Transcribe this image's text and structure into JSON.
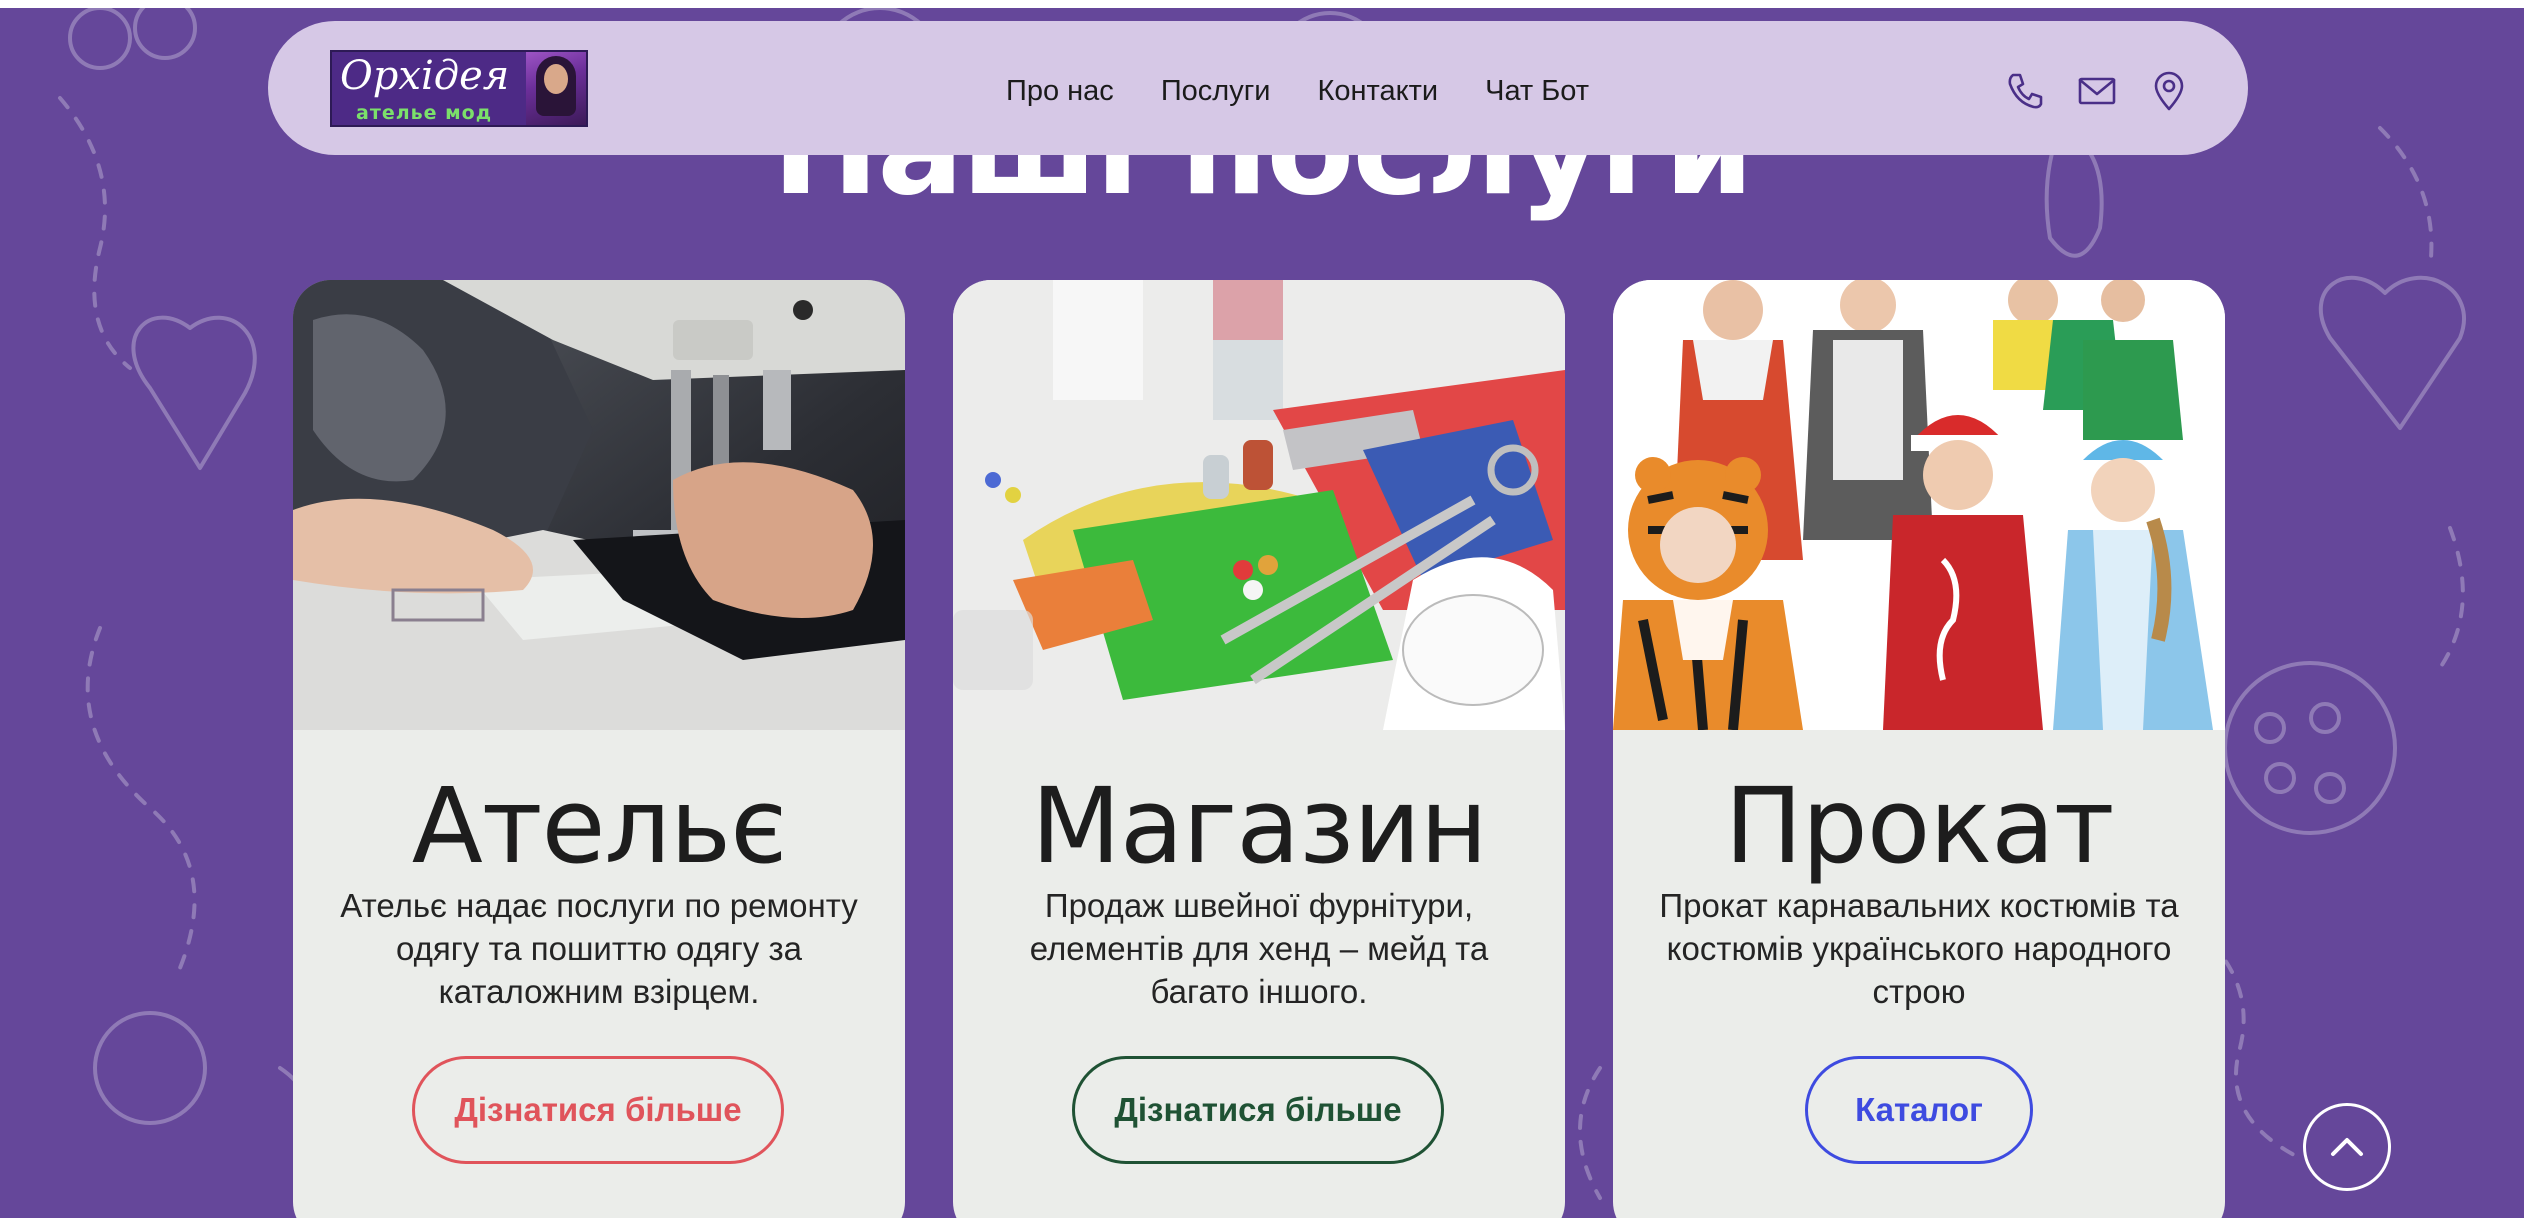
{
  "brand": {
    "logo_text": "Орхідея",
    "logo_subtext": "ателье мод"
  },
  "nav": {
    "items": [
      {
        "label": "Про нас"
      },
      {
        "label": "Послуги"
      },
      {
        "label": "Контакти"
      },
      {
        "label": "Чат Бот"
      }
    ]
  },
  "header_icons": [
    "phone-icon",
    "mail-icon",
    "map-pin-icon"
  ],
  "section": {
    "title": "Наші послуги"
  },
  "cards": [
    {
      "title": "Ательє",
      "description": "Ательє надає послуги по ремонту одягу та пошиттю одягу за каталожним взірцем.",
      "button_label": "Дізнатися більше",
      "button_color": "#e0545b",
      "image": "sewing-machine-photo"
    },
    {
      "title": "Магазин",
      "description": "Продаж швейної фурнітури, елементів для хенд – мейд та багато іншого.",
      "button_label": "Дізнатися більше",
      "button_color": "#1f5234",
      "image": "sewing-supplies-photo"
    },
    {
      "title": "Прокат",
      "description": "Прокат карнавальних костюмів та костюмів українського народного строю",
      "button_label": "Каталог",
      "button_color": "#3e4be0",
      "image": "kids-costumes-photo"
    }
  ],
  "colors": {
    "background": "#65479a",
    "header": "#d6c8e6",
    "card": "#ebedea",
    "icon": "#4a2f88"
  },
  "scroll_top_icon": "chevron-up-icon"
}
